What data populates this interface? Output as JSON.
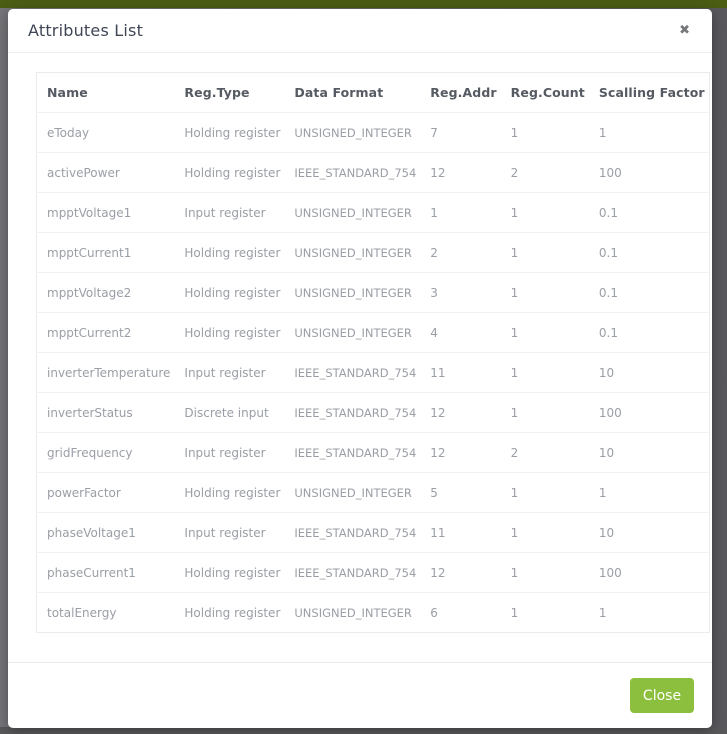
{
  "modal": {
    "title": "Attributes List",
    "close_icon": "✖",
    "close_button_label": "Close"
  },
  "table": {
    "columns": [
      "Name",
      "Reg.Type",
      "Data Format",
      "Reg.Addr",
      "Reg.Count",
      "Scalling Factor"
    ],
    "rows": [
      [
        "eToday",
        "Holding register",
        "UNSIGNED_INTEGER",
        "7",
        "1",
        "1"
      ],
      [
        "activePower",
        "Holding register",
        "IEEE_STANDARD_754",
        "12",
        "2",
        "100"
      ],
      [
        "mpptVoltage1",
        "Input register",
        "UNSIGNED_INTEGER",
        "1",
        "1",
        "0.1"
      ],
      [
        "mpptCurrent1",
        "Holding register",
        "UNSIGNED_INTEGER",
        "2",
        "1",
        "0.1"
      ],
      [
        "mpptVoltage2",
        "Holding register",
        "UNSIGNED_INTEGER",
        "3",
        "1",
        "0.1"
      ],
      [
        "mpptCurrent2",
        "Holding register",
        "UNSIGNED_INTEGER",
        "4",
        "1",
        "0.1"
      ],
      [
        "inverterTemperature",
        "Input register",
        "IEEE_STANDARD_754",
        "11",
        "1",
        "10"
      ],
      [
        "inverterStatus",
        "Discrete input",
        "IEEE_STANDARD_754",
        "12",
        "1",
        "100"
      ],
      [
        "gridFrequency",
        "Input register",
        "IEEE_STANDARD_754",
        "12",
        "2",
        "10"
      ],
      [
        "powerFactor",
        "Holding register",
        "UNSIGNED_INTEGER",
        "5",
        "1",
        "1"
      ],
      [
        "phaseVoltage1",
        "Input register",
        "IEEE_STANDARD_754",
        "11",
        "1",
        "10"
      ],
      [
        "phaseCurrent1",
        "Holding register",
        "IEEE_STANDARD_754",
        "12",
        "1",
        "100"
      ],
      [
        "totalEnergy",
        "Holding register",
        "UNSIGNED_INTEGER",
        "6",
        "1",
        "1"
      ]
    ]
  },
  "colors": {
    "accent_green": "#8dbf3e",
    "page_header_olive": "#4b5e14",
    "backdrop_gray": "#69696d"
  }
}
